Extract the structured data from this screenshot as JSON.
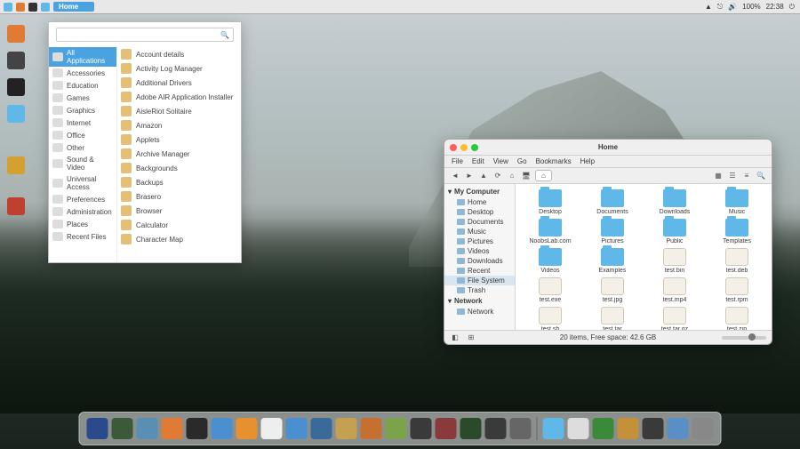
{
  "panel": {
    "home_label": "Home",
    "battery": "100%",
    "time": "22:38"
  },
  "appmenu": {
    "search_placeholder": "",
    "categories": [
      "All Applications",
      "Accessories",
      "Education",
      "Games",
      "Graphics",
      "Internet",
      "Office",
      "Other",
      "Sound & Video",
      "Universal Access",
      "Preferences",
      "Administration",
      "Places",
      "Recent Files"
    ],
    "selected_category_index": 0,
    "apps": [
      "Account details",
      "Activity Log Manager",
      "Additional Drivers",
      "Adobe AIR Application Installer",
      "AisleRiot Solitaire",
      "Amazon",
      "Applets",
      "Archive Manager",
      "Backgrounds",
      "Backups",
      "Brasero",
      "Browser",
      "Calculator",
      "Character Map"
    ]
  },
  "fm": {
    "title": "Home",
    "menus": [
      "File",
      "Edit",
      "View",
      "Go",
      "Bookmarks",
      "Help"
    ],
    "path_label": "⌂",
    "sidebar": {
      "section1": "My Computer",
      "items1": [
        "Home",
        "Desktop",
        "Documents",
        "Music",
        "Pictures",
        "Videos",
        "Downloads",
        "Recent",
        "File System",
        "Trash"
      ],
      "selected_item": "File System",
      "section2": "Network",
      "items2": [
        "Network"
      ]
    },
    "grid": [
      {
        "name": "Desktop",
        "type": "folder"
      },
      {
        "name": "Documents",
        "type": "folder"
      },
      {
        "name": "Downloads",
        "type": "folder"
      },
      {
        "name": "Music",
        "type": "folder"
      },
      {
        "name": "NoobsLab.com",
        "type": "folder"
      },
      {
        "name": "Pictures",
        "type": "folder"
      },
      {
        "name": "Public",
        "type": "folder"
      },
      {
        "name": "Templates",
        "type": "folder"
      },
      {
        "name": "Videos",
        "type": "folder"
      },
      {
        "name": "Examples",
        "type": "folder"
      },
      {
        "name": "test.bin",
        "type": "file"
      },
      {
        "name": "test.deb",
        "type": "file"
      },
      {
        "name": "test.exe",
        "type": "file"
      },
      {
        "name": "test.jpg",
        "type": "file"
      },
      {
        "name": "test.mp4",
        "type": "file"
      },
      {
        "name": "test.rpm",
        "type": "file"
      },
      {
        "name": "test.sh",
        "type": "file"
      },
      {
        "name": "test.tar",
        "type": "file"
      },
      {
        "name": "test.tar.gz",
        "type": "file"
      },
      {
        "name": "test.zip",
        "type": "file"
      }
    ],
    "status": "20 items, Free space: 42.6 GB"
  },
  "dock_colors": [
    "#2b4a8c",
    "#3a5a3a",
    "#5a8fb5",
    "#e07b35",
    "#2a2a2a",
    "#4a8fd0",
    "#e69030",
    "#eee",
    "#4a8fd0",
    "#3a6a9a",
    "#c5a050",
    "#c57030",
    "#7aa34a",
    "#3a3a3a",
    "#8a3a3a",
    "#2a4a2a",
    "#3a3a3a",
    "#666",
    "#5fb8e8",
    "#ddd",
    "#3a8a3a",
    "#c5903a",
    "#3a3a3a",
    "#5a8fc5",
    "#888"
  ],
  "launcher_colors": [
    "#e07b35",
    "#444",
    "#222",
    "#5fb8e8",
    "",
    "#d4a030",
    "",
    "#c04030"
  ]
}
